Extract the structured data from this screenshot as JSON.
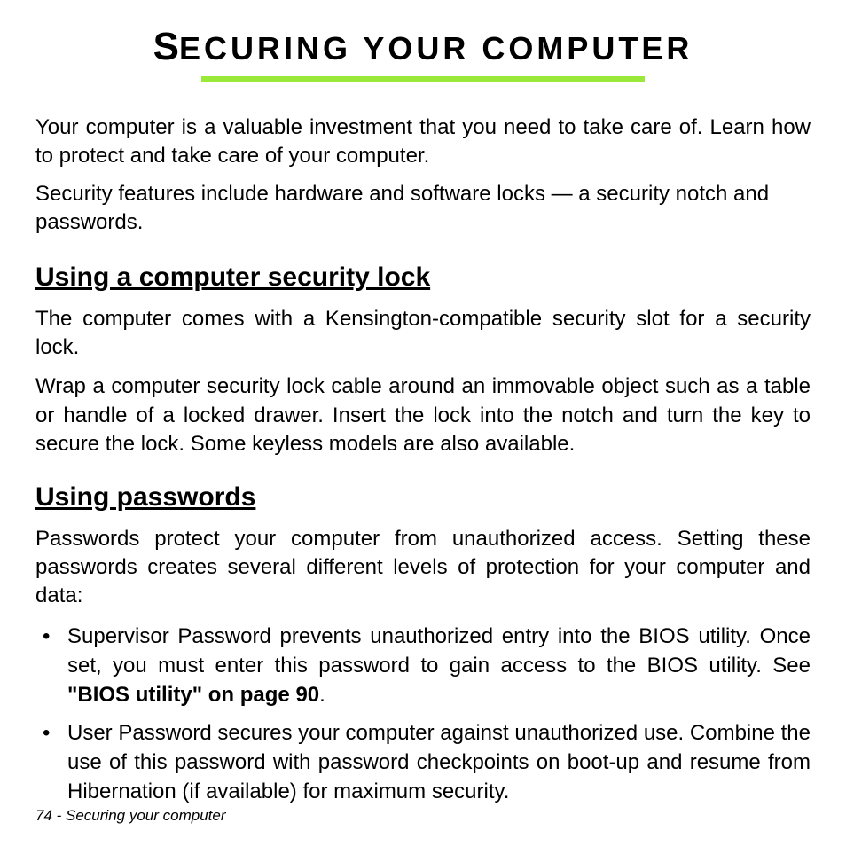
{
  "title_first_letter": "S",
  "title_rest": "ECURING YOUR COMPUTER",
  "intro": {
    "para1": "Your computer is a valuable investment that you need to take care of. Learn how to protect and take care of your computer.",
    "para2": "Security features include hardware and software locks — a security notch and passwords."
  },
  "section1": {
    "heading": "Using a computer security lock",
    "para1": "The computer comes with a Kensington-compatible security slot for a security lock.",
    "para2": "Wrap a computer security lock cable around an immovable object such as a table or handle of a locked drawer. Insert the lock into the notch and turn the key to secure the lock. Some keyless models are also available."
  },
  "section2": {
    "heading": "Using passwords",
    "para1": "Passwords protect your computer from unauthorized access. Setting these passwords creates several different levels of protection for your computer and data:",
    "bullets": [
      {
        "pre": "Supervisor Password prevents unauthorized entry into the BIOS utility. Once set, you must enter this password to gain access to the BIOS utility. See ",
        "bold": "\"BIOS utility\" on page 90",
        "post": "."
      },
      {
        "full": "User Password secures your computer against unauthorized use. Combine the use of this password with password checkpoints on boot-up and resume from Hibernation (if available) for maximum security."
      }
    ]
  },
  "footer": "74 - Securing your computer"
}
